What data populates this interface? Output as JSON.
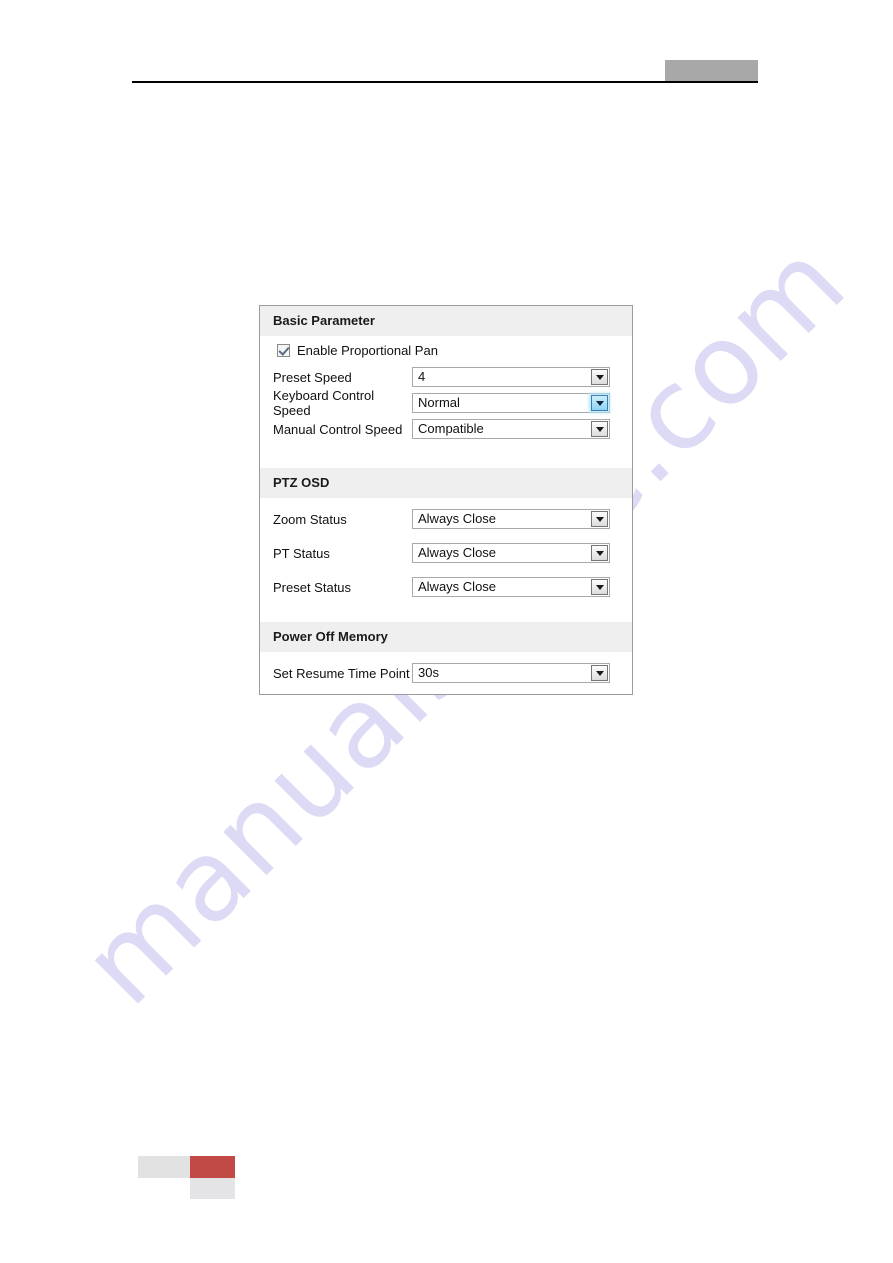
{
  "header": {
    "redaction_label": "",
    "rule": "horizontal-rule"
  },
  "panel": {
    "sections": [
      {
        "id": "basic-parameter",
        "title": "Basic Parameter",
        "checkbox": {
          "label": "Enable Proportional Pan",
          "checked": true
        },
        "fields": [
          {
            "label": "Preset Speed",
            "value": "4",
            "focused": false
          },
          {
            "label": "Keyboard Control Speed",
            "value": "Normal",
            "focused": true
          },
          {
            "label": "Manual Control Speed",
            "value": "Compatible",
            "focused": false
          }
        ]
      },
      {
        "id": "ptz-osd",
        "title": "PTZ OSD",
        "fields": [
          {
            "label": "Zoom Status",
            "value": "Always Close",
            "focused": false
          },
          {
            "label": "PT Status",
            "value": "Always Close",
            "focused": false
          },
          {
            "label": "Preset Status",
            "value": "Always Close",
            "focused": false
          }
        ]
      },
      {
        "id": "power-off-memory",
        "title": "Power Off Memory",
        "fields": [
          {
            "label": "Set Resume Time Point",
            "value": "30s",
            "focused": false
          }
        ]
      }
    ]
  },
  "watermark": {
    "text": "manualshive.com"
  },
  "colors": {
    "section_header_bg": "#efefef",
    "panel_border": "#9b9b9b",
    "focus_blue": "#8fd3f2",
    "footer_red": "#c24a46",
    "footer_gray": "#e2e2e2",
    "header_redaction_gray": "#a8a8a8",
    "watermark": "#dcdaf4"
  }
}
